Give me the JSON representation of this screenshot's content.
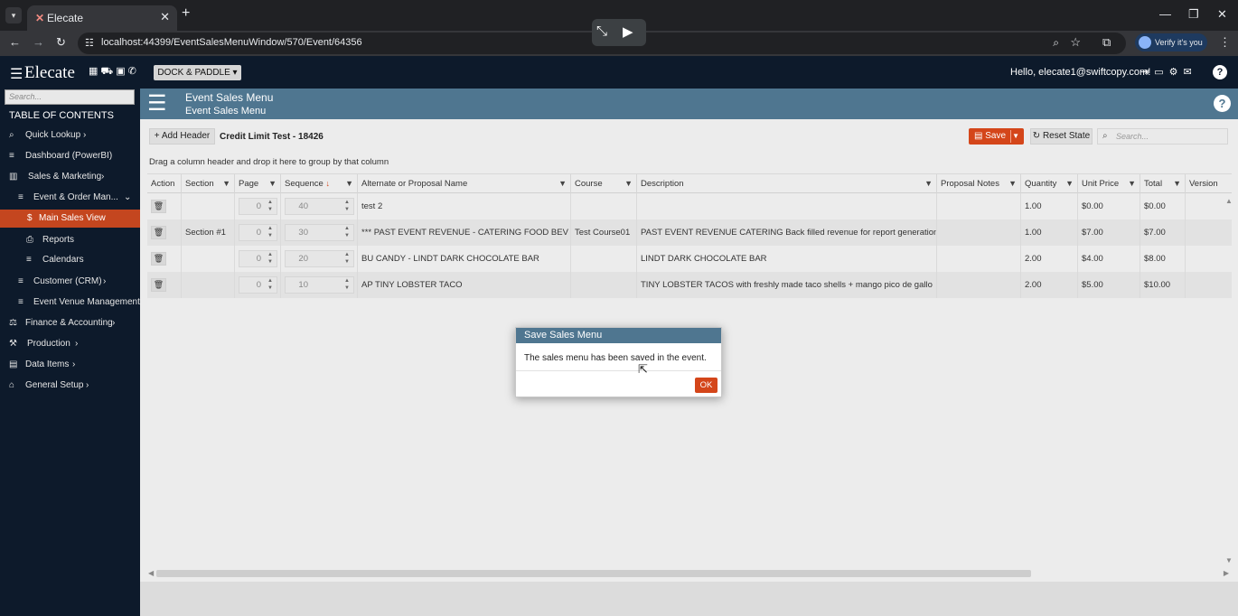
{
  "browser": {
    "tab_title": "Elecate",
    "url": "localhost:44399/EventSalesMenuWindow/570/Event/64356",
    "verify_label": "Verify it's you"
  },
  "app": {
    "logo": "Elecate",
    "org_selector": "DOCK & PADDLE",
    "greeting": "Hello, elecate1@swiftcopy.com!"
  },
  "sidebar": {
    "search_placeholder": "Search...",
    "toc_label": "TABLE OF CONTENTS",
    "items": [
      {
        "label": "Quick Lookup",
        "icon": "search-icon"
      },
      {
        "label": "Dashboard (PowerBI)",
        "icon": "list-icon"
      },
      {
        "label": "Sales & Marketing",
        "icon": "chart-icon"
      },
      {
        "label": "Event & Order Man...",
        "icon": "list-icon"
      },
      {
        "label": "Main Sales View",
        "icon": "dollar-icon"
      },
      {
        "label": "Reports",
        "icon": "print-icon"
      },
      {
        "label": "Calendars",
        "icon": "list-icon"
      },
      {
        "label": "Customer (CRM)",
        "icon": "list-icon"
      },
      {
        "label": "Event Venue Management",
        "icon": "list-icon"
      },
      {
        "label": "Finance & Accounting",
        "icon": "finance-icon"
      },
      {
        "label": "Production",
        "icon": "production-icon"
      },
      {
        "label": "Data Items",
        "icon": "data-icon"
      },
      {
        "label": "General Setup",
        "icon": "setup-icon"
      }
    ]
  },
  "page": {
    "banner_title": "Event Sales Menu",
    "banner_subtitle": "Event Sales Menu",
    "add_header_label": "Add Header",
    "breadcrumb": "Credit Limit Test - 18426",
    "save_label": "Save",
    "reset_label": "Reset State",
    "search_placeholder": "Search...",
    "group_hint": "Drag a column header and drop it here to group by that column"
  },
  "grid": {
    "columns": [
      "Action",
      "Section",
      "Page",
      "Sequence",
      "Alternate or Proposal Name",
      "Course",
      "Description",
      "Proposal Notes",
      "Quantity",
      "Unit Price",
      "Total",
      "Version"
    ],
    "rows": [
      {
        "section": "",
        "page": "0",
        "sequence": "40",
        "name": "test 2",
        "course": "",
        "description": "",
        "notes": "",
        "quantity": "1.00",
        "unit_price": "$0.00",
        "total": "$0.00",
        "version": ""
      },
      {
        "section": "Section #1",
        "page": "0",
        "sequence": "30",
        "name": "*** PAST EVENT REVENUE - CATERING FOOD BEV",
        "course": "Test Course01",
        "description": "PAST EVENT REVENUE CATERING Back filled revenue for report generation",
        "notes": "",
        "quantity": "1.00",
        "unit_price": "$7.00",
        "total": "$7.00",
        "version": ""
      },
      {
        "section": "",
        "page": "0",
        "sequence": "20",
        "name": "BU CANDY - LINDT DARK CHOCOLATE BAR",
        "course": "",
        "description": "LINDT DARK CHOCOLATE BAR",
        "notes": "",
        "quantity": "2.00",
        "unit_price": "$4.00",
        "total": "$8.00",
        "version": ""
      },
      {
        "section": "",
        "page": "0",
        "sequence": "10",
        "name": "AP TINY LOBSTER TACO",
        "course": "",
        "description": "TINY LOBSTER TACOS with freshly made taco shells + mango pico de gallo",
        "notes": "",
        "quantity": "2.00",
        "unit_price": "$5.00",
        "total": "$10.00",
        "version": ""
      }
    ]
  },
  "dialog": {
    "title": "Save Sales Menu",
    "message": "The sales menu has been saved in the event.",
    "ok_label": "OK"
  },
  "colors": {
    "accent": "#d4461a",
    "banner": "#4f7690",
    "nav_bg": "#0d1a2b"
  }
}
